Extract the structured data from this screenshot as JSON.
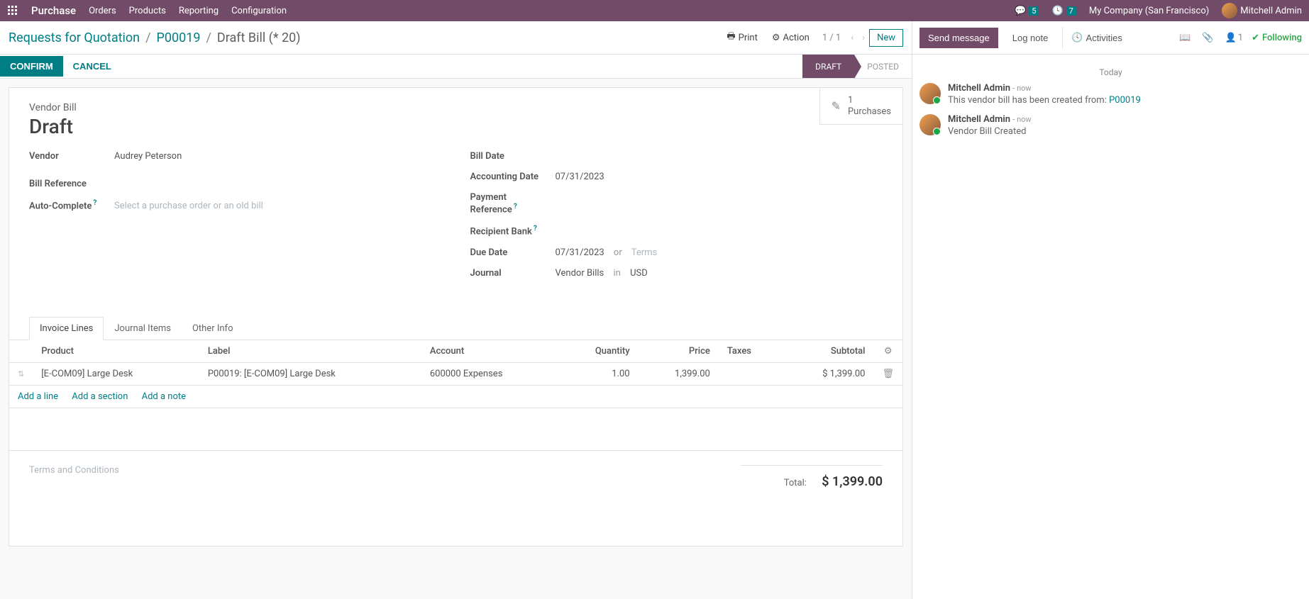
{
  "navbar": {
    "brand": "Purchase",
    "links": [
      "Orders",
      "Products",
      "Reporting",
      "Configuration"
    ],
    "messages_badge": "5",
    "activities_badge": "7",
    "company": "My Company (San Francisco)",
    "user": "Mitchell Admin"
  },
  "breadcrumb": {
    "root": "Requests for Quotation",
    "parent": "P00019",
    "current": "Draft Bill (* 20)"
  },
  "controls": {
    "print": "Print",
    "action": "Action",
    "pager": "1 / 1",
    "new": "New"
  },
  "status": {
    "confirm": "CONFIRM",
    "cancel": "CANCEL",
    "steps": [
      "DRAFT",
      "POSTED"
    ],
    "active": "DRAFT"
  },
  "stat": {
    "count": "1",
    "label": "Purchases"
  },
  "doc": {
    "type": "Vendor Bill",
    "status": "Draft"
  },
  "fields": {
    "vendor_label": "Vendor",
    "vendor": "Audrey Peterson",
    "billref_label": "Bill Reference",
    "billref": "",
    "autocomplete_label": "Auto-Complete",
    "autocomplete_placeholder": "Select a purchase order or an old bill",
    "billdate_label": "Bill Date",
    "billdate": "",
    "acctdate_label": "Accounting Date",
    "acctdate": "07/31/2023",
    "payref_label": "Payment Reference",
    "payref": "",
    "bank_label": "Recipient Bank",
    "bank": "",
    "duedate_label": "Due Date",
    "duedate": "07/31/2023",
    "or": "or",
    "terms_placeholder": "Terms",
    "journal_label": "Journal",
    "journal": "Vendor Bills",
    "in": "in",
    "currency": "USD"
  },
  "tabs": [
    "Invoice Lines",
    "Journal Items",
    "Other Info"
  ],
  "table": {
    "headers": [
      "Product",
      "Label",
      "Account",
      "Quantity",
      "Price",
      "Taxes",
      "Subtotal"
    ],
    "rows": [
      {
        "product": "[E-COM09] Large Desk",
        "label": "P00019: [E-COM09] Large Desk",
        "account": "600000 Expenses",
        "qty": "1.00",
        "price": "1,399.00",
        "taxes": "",
        "subtotal": "$ 1,399.00"
      }
    ],
    "add_line": "Add a line",
    "add_section": "Add a section",
    "add_note": "Add a note"
  },
  "footer": {
    "terms_placeholder": "Terms and Conditions",
    "total_label": "Total:",
    "total": "$ 1,399.00"
  },
  "chatter": {
    "send": "Send message",
    "log": "Log note",
    "activities": "Activities",
    "follower_count": "1",
    "following": "Following",
    "date_sep": "Today",
    "messages": [
      {
        "author": "Mitchell Admin",
        "time": "- now",
        "text": "This vendor bill has been created from: ",
        "link": "P00019"
      },
      {
        "author": "Mitchell Admin",
        "time": "- now",
        "text": "Vendor Bill Created",
        "link": ""
      }
    ]
  }
}
